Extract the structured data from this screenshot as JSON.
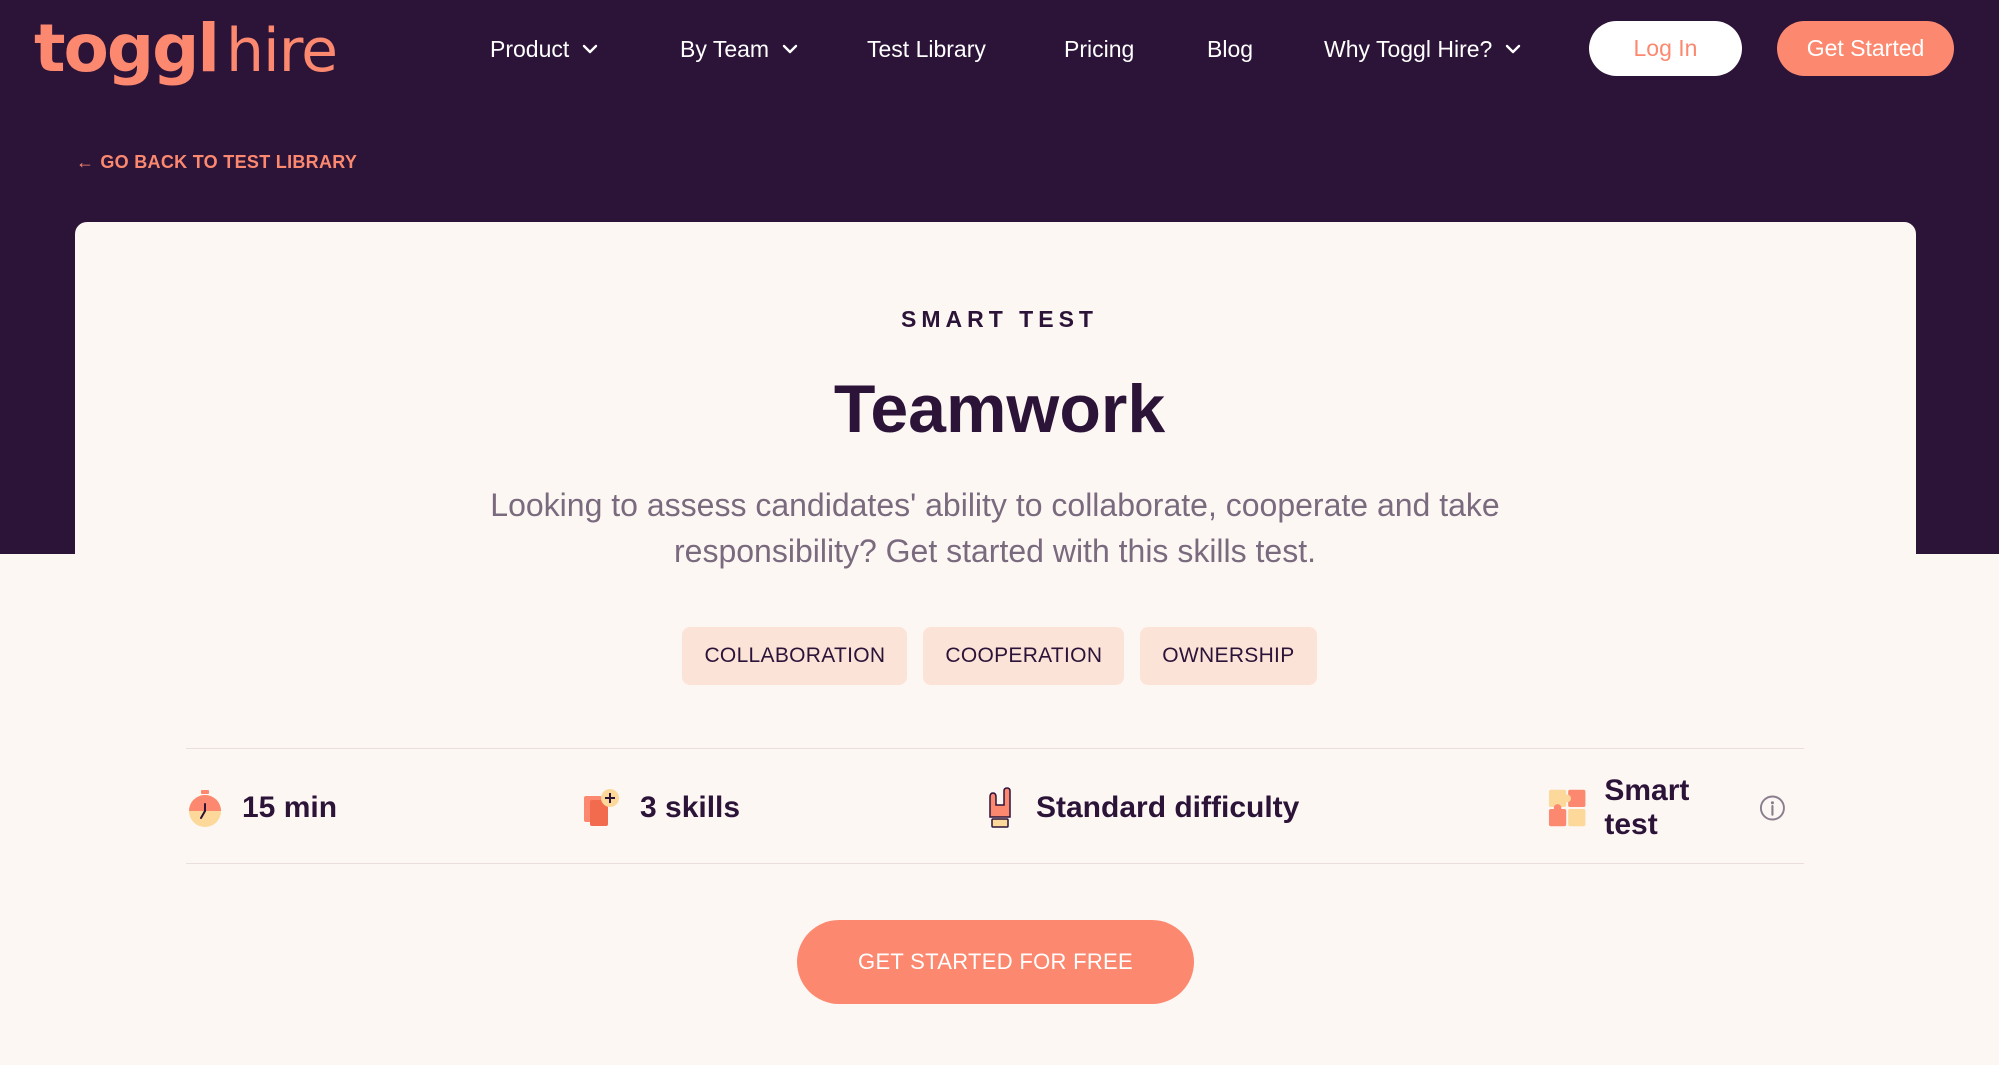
{
  "brand": {
    "logo_main": "toggl",
    "logo_sub": "hire"
  },
  "nav": {
    "items": [
      {
        "label": "Product",
        "dropdown": true
      },
      {
        "label": "By Team",
        "dropdown": true
      },
      {
        "label": "Test Library",
        "dropdown": false
      },
      {
        "label": "Pricing",
        "dropdown": false
      },
      {
        "label": "Blog",
        "dropdown": false
      },
      {
        "label": "Why Toggl Hire?",
        "dropdown": true
      }
    ],
    "login_label": "Log In",
    "get_started_label": "Get Started"
  },
  "back_link": "GO BACK TO TEST LIBRARY",
  "test": {
    "eyebrow": "SMART TEST",
    "title": "Teamwork",
    "description": "Looking to assess candidates' ability to collaborate, cooperate and take responsibility? Get started with this skills test.",
    "tags": [
      "COLLABORATION",
      "COOPERATION",
      "OWNERSHIP"
    ],
    "stats": {
      "duration": "15 min",
      "skills": "3 skills",
      "difficulty": "Standard difficulty",
      "type": "Smart test"
    },
    "cta_label": "GET STARTED FOR FREE"
  },
  "colors": {
    "brand_coral": "#fc896f",
    "dark_purple": "#2c1338",
    "tag_bg": "#fbe3d8",
    "page_bg": "#fdf7f4"
  }
}
